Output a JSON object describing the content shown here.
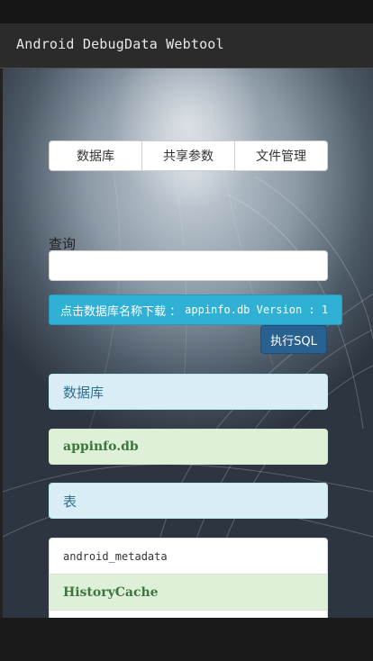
{
  "app": {
    "title": "Android DebugData Webtool"
  },
  "tabs": [
    {
      "label": "数据库"
    },
    {
      "label": "共享参数"
    },
    {
      "label": "文件管理"
    }
  ],
  "query": {
    "label": "查询",
    "value": ""
  },
  "download": {
    "text": "点击数据库名称下载 ：",
    "db_info": "appinfo.db Version : 1"
  },
  "execute_button": {
    "label": "执行SQL"
  },
  "database_section": {
    "header": "数据库",
    "selected": "appinfo.db"
  },
  "tables_section": {
    "header": "表",
    "items": [
      "android_metadata",
      "HistoryCache"
    ]
  },
  "colors": {
    "info": "#31b0d5",
    "primary": "#286090",
    "panel_info": "#d9edf7",
    "panel_success": "#dff0d8"
  }
}
